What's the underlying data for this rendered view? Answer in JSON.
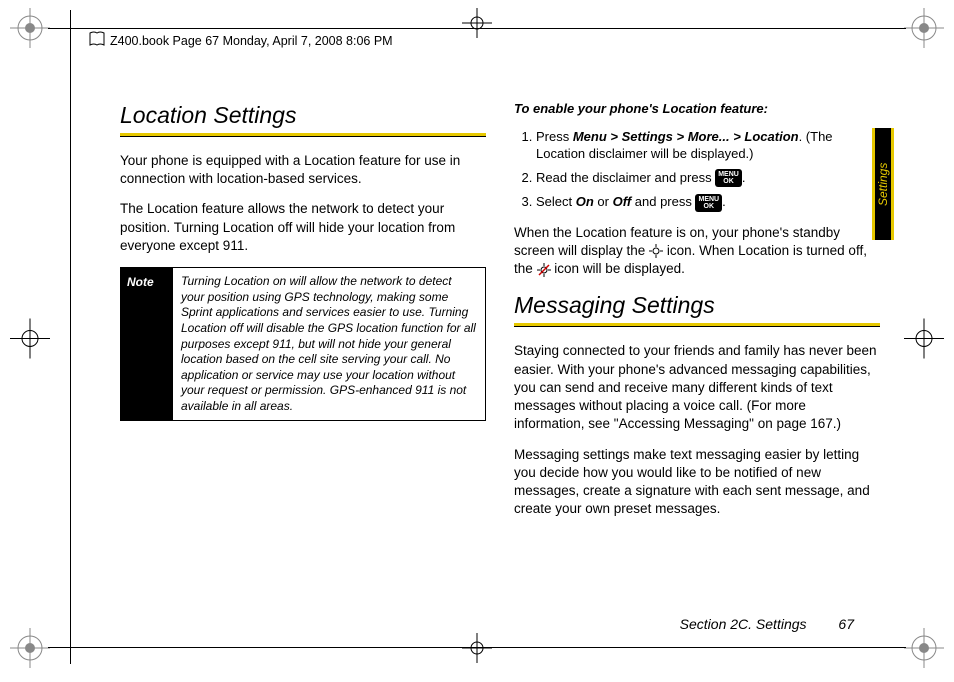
{
  "header": "Z400.book  Page 67  Monday, April 7, 2008  8:06 PM",
  "left": {
    "heading": "Location Settings",
    "p1": "Your phone is equipped with a Location feature for use in connection with location-based services.",
    "p2": "The Location feature allows the network to detect your position. Turning Location off will hide your location from everyone except 911.",
    "note_label": "Note",
    "note_text": "Turning Location on will allow the network to detect your position using GPS technology, making some Sprint applications and services easier to use. Turning Location off will disable the GPS location function for all purposes except 911, but will not hide your general location based on the cell site serving your call. No application or service may use your location without your request or permission. GPS-enhanced 911 is not available in all areas."
  },
  "right": {
    "instr_head": "To enable your phone's Location feature:",
    "step1_a": "Press ",
    "step1_menu": "Menu > Settings > More... > Location",
    "step1_b": ". (The Location disclaimer will be displayed.)",
    "step2_a": "Read the disclaimer and press ",
    "step2_b": ".",
    "step3_a": "Select ",
    "step3_on": "On",
    "step3_or": " or ",
    "step3_off": "Off",
    "step3_b": " and press ",
    "step3_c": ".",
    "after_a": "When the Location feature is on, your phone's standby screen will display the ",
    "after_b": " icon. When Location is turned off, the ",
    "after_c": " icon will be displayed.",
    "heading2": "Messaging Settings",
    "p3": "Staying connected to your friends and family has never been easier. With your phone's advanced messaging capabilities, you can send and receive many different kinds of text messages without placing a voice call. (For more information, see \"Accessing Messaging\" on page 167.)",
    "p4": "Messaging settings make text messaging easier by letting you decide how you would like to be notified of new messages, create a signature with each sent message, and create your own preset messages."
  },
  "key_label_top": "MENU",
  "key_label_bot": "OK",
  "footer_section": "Section 2C. Settings",
  "footer_page": "67",
  "tab": "Settings"
}
